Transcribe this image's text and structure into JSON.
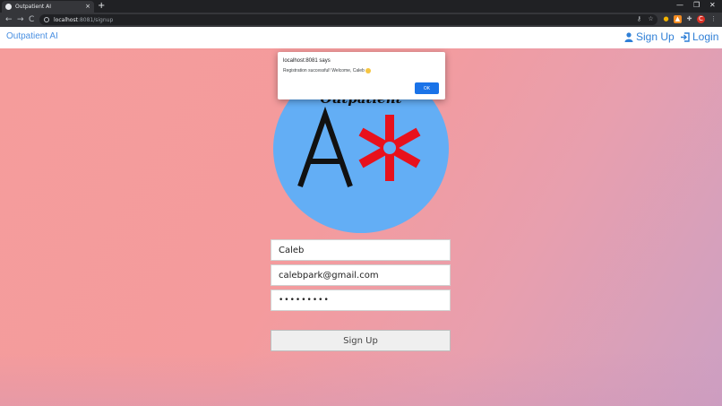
{
  "browser": {
    "tab_title": "Outpatient AI",
    "tab_close": "×",
    "new_tab": "+",
    "window_controls": {
      "minimize": "—",
      "restore": "❐",
      "close": "✕"
    },
    "url_host": "localhost",
    "url_rest": ":8081/signup",
    "nav": {
      "back": "←",
      "forward": "→",
      "reload": "C"
    },
    "profile_initial": "C"
  },
  "app": {
    "brand": "Outpatient AI",
    "nav": {
      "signup": "Sign Up",
      "login": "Login"
    },
    "logo_text": "Outpatient"
  },
  "form": {
    "name_value": "Caleb",
    "email_value": "calebpark@gmail.com",
    "password_mask": "•••••••••",
    "submit_label": "Sign Up"
  },
  "dialog": {
    "origin": "localhost:8081 says",
    "message": "Registration successful! Welcome, Caleb",
    "ok_label": "OK"
  },
  "colors": {
    "brand_blue": "#2f7fd6",
    "logo_circle": "#63aef5",
    "logo_asterisk": "#e8111c",
    "dialog_ok": "#1a73e8"
  }
}
